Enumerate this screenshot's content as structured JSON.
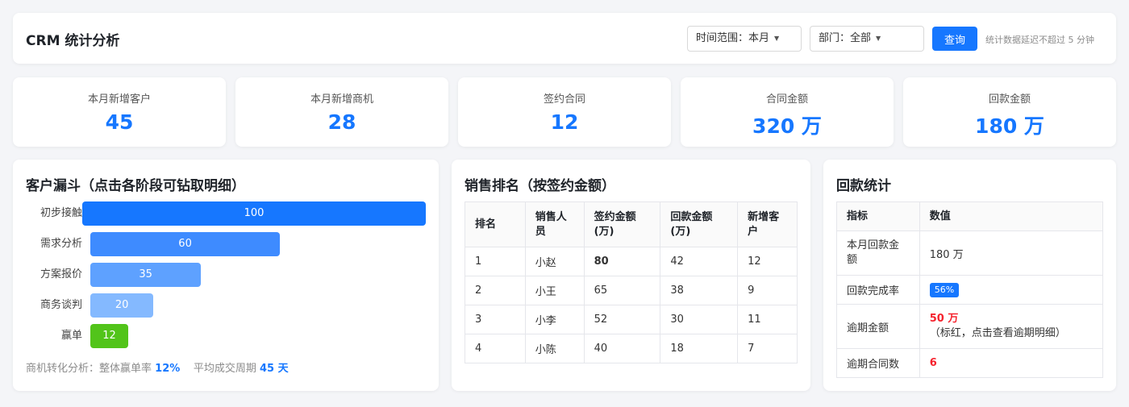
{
  "header": {
    "title": "CRM 统计分析",
    "time_filter": "时间范围：本月",
    "dept_filter": "部门：全部",
    "query_label": "查询",
    "delay_note": "统计数据延迟不超过 5 分钟"
  },
  "kpis": [
    {
      "label": "本月新增客户",
      "value": "45"
    },
    {
      "label": "本月新增商机",
      "value": "28"
    },
    {
      "label": "签约合同",
      "value": "12"
    },
    {
      "label": "合同金额",
      "value": "320 万"
    },
    {
      "label": "回款金额",
      "value": "180 万"
    }
  ],
  "funnel": {
    "title": "客户漏斗（点击各阶段可钻取明细）",
    "stages": [
      {
        "label": "初步接触",
        "value": 100,
        "color": "#1677ff"
      },
      {
        "label": "需求分析",
        "value": 60,
        "color": "#3e8bff"
      },
      {
        "label": "方案报价",
        "value": 35,
        "color": "#5ea1ff"
      },
      {
        "label": "商务谈判",
        "value": 20,
        "color": "#84b9ff"
      },
      {
        "label": "赢单",
        "value": 12,
        "color": "#52c41a"
      }
    ],
    "summary_prefix": "商机转化分析：整体赢单率",
    "win_rate": "12%",
    "cycle_label": "平均成交周期",
    "cycle_value": "45 天"
  },
  "ranking": {
    "title": "销售排名（按签约金额）",
    "columns": [
      "排名",
      "销售人员",
      "签约金额(万)",
      "回款金额(万)",
      "新增客户"
    ],
    "rows": [
      [
        "1",
        "小赵",
        "80",
        "42",
        "12"
      ],
      [
        "2",
        "小王",
        "65",
        "38",
        "9"
      ],
      [
        "3",
        "小李",
        "52",
        "30",
        "11"
      ],
      [
        "4",
        "小陈",
        "40",
        "18",
        "7"
      ]
    ]
  },
  "payment": {
    "title": "回款统计",
    "columns": [
      "指标",
      "数值"
    ],
    "rows": {
      "r0_label": "本月回款金额",
      "r0_value": "180 万",
      "r1_label": "回款完成率",
      "r1_value": "56%",
      "r2_label": "逾期金额",
      "r2_value": "50 万",
      "r2_note": "（标红，点击查看逾期明细）",
      "r3_label": "逾期合同数",
      "r3_value": "6"
    }
  }
}
